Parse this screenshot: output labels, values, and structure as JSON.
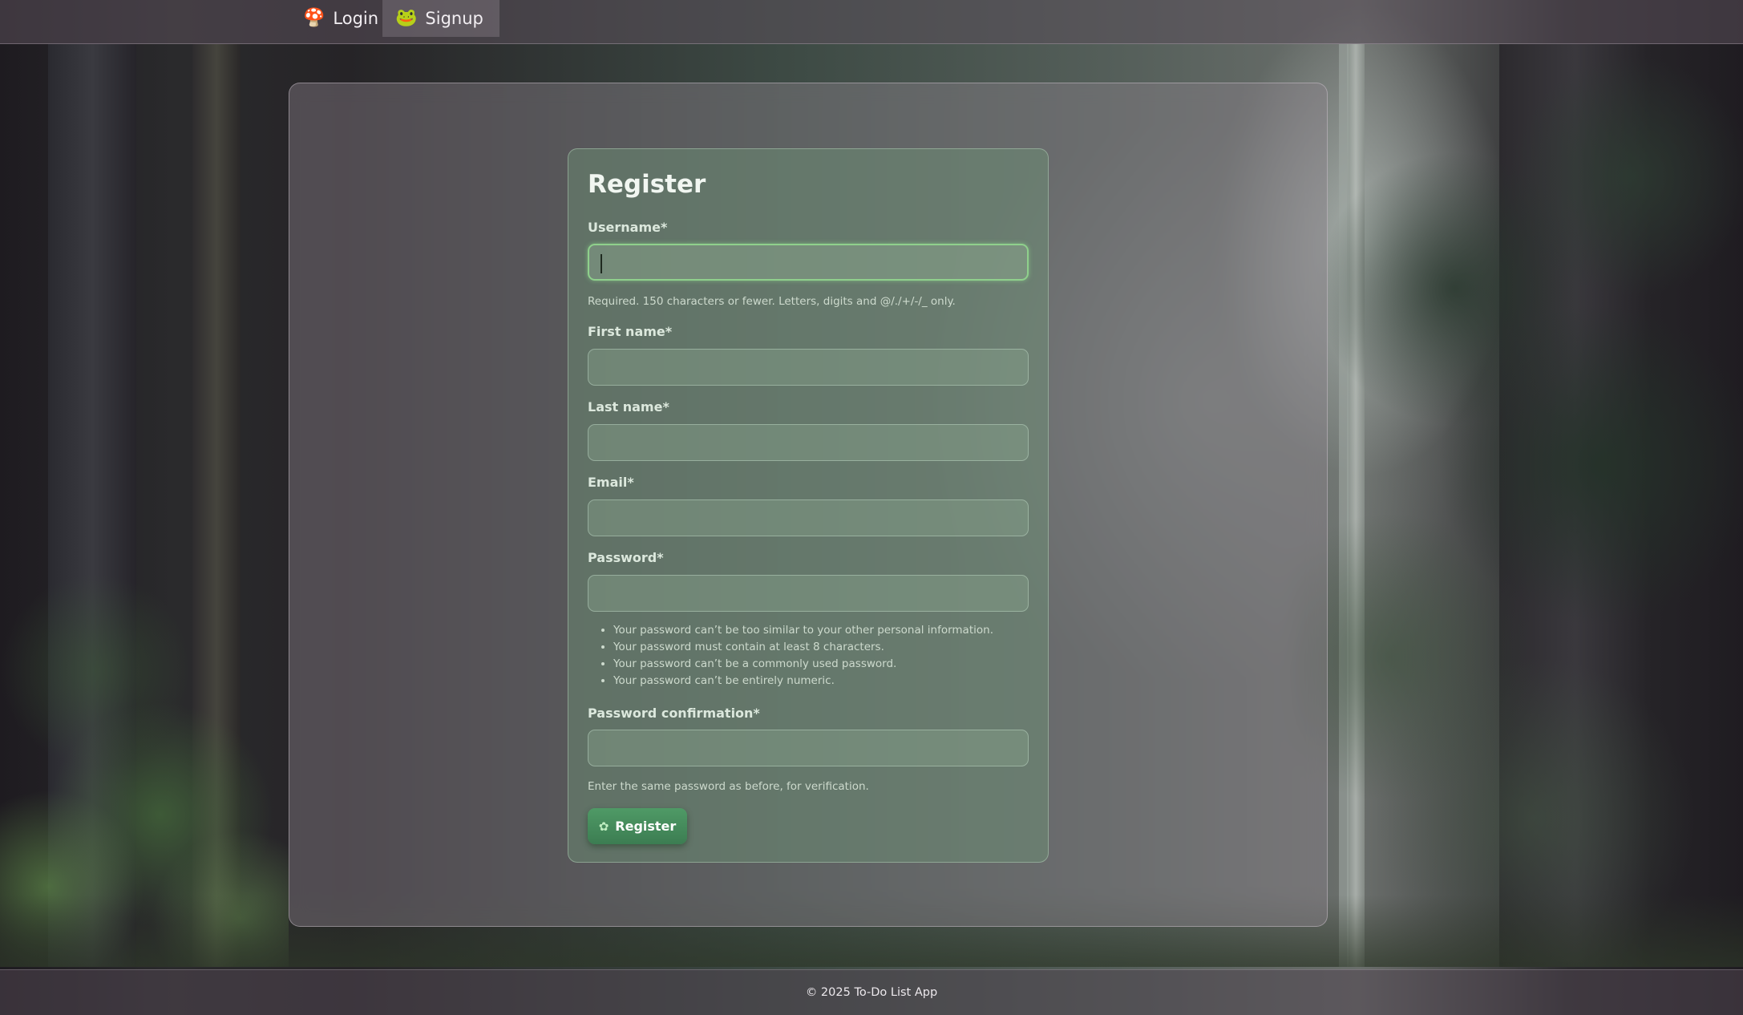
{
  "nav": {
    "items": [
      {
        "icon": "mushroom-icon",
        "glyph": "🍄",
        "label": "Login"
      },
      {
        "icon": "frog-icon",
        "glyph": "🐸",
        "label": "Signup",
        "active": true
      }
    ]
  },
  "form": {
    "title": "Register",
    "fields": {
      "username": {
        "label": "Username*",
        "value": "",
        "help": "Required. 150 characters or fewer. Letters, digits and @/./+/-/_ only."
      },
      "first_name": {
        "label": "First name*",
        "value": ""
      },
      "last_name": {
        "label": "Last name*",
        "value": ""
      },
      "email": {
        "label": "Email*",
        "value": ""
      },
      "password": {
        "label": "Password*",
        "value": ""
      },
      "password_confirmation": {
        "label": "Password confirmation*",
        "value": "",
        "help": "Enter the same password as before, for verification."
      }
    },
    "password_rules": [
      "Your password can’t be too similar to your other personal information.",
      "Your password must contain at least 8 characters.",
      "Your password can’t be a commonly used password.",
      "Your password can’t be entirely numeric."
    ],
    "submit": {
      "icon": "sprout-icon",
      "glyph": "✿",
      "label": "Register"
    }
  },
  "footer": {
    "text": "© 2025 To-Do List App"
  },
  "colors": {
    "accent": "#4f9a66",
    "focus_border": "#8fd08c"
  }
}
